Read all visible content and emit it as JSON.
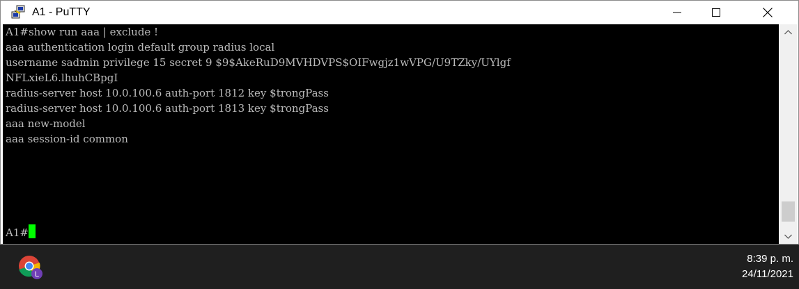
{
  "window": {
    "title": "A1 - PuTTY",
    "icon": "putty-icon"
  },
  "window_controls": {
    "minimize_icon": "minimize-icon",
    "maximize_icon": "maximize-icon",
    "close_icon": "close-icon"
  },
  "terminal": {
    "background": "#000000",
    "text_color": "#bbbbbb",
    "cursor_color": "#00ff00",
    "lines": [
      "A1#show run aaa | exclude !",
      "aaa authentication login default group radius local",
      "username sadmin privilege 15 secret 9 $9$AkeRuD9MVHDVPS$OIFwgjz1wVPG/U9TZky/UYlgf",
      "NFLxieL6.lhuhCBpgI",
      "radius-server host 10.0.100.6 auth-port 1812 key $trongPass",
      "radius-server host 10.0.100.6 auth-port 1813 key $trongPass",
      "aaa new-model",
      "aaa session-id common",
      "",
      "A1#"
    ]
  },
  "scrollbar": {
    "up_icon": "scroll-up-arrow-icon",
    "down_icon": "scroll-down-arrow-icon"
  },
  "taskbar": {
    "app_icon": "chrome-profile-icon",
    "time": "8:39 p. m.",
    "date": "24/11/2021"
  }
}
